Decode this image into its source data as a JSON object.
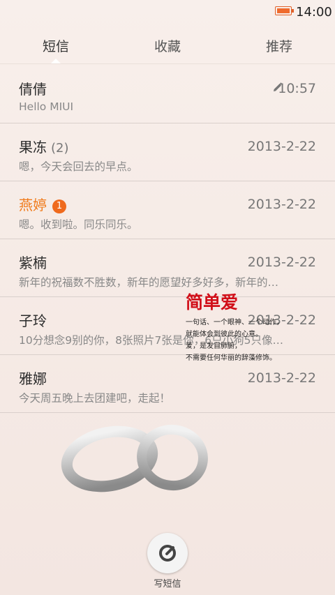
{
  "status_bar": {
    "time": "14:00"
  },
  "tabs": [
    {
      "label": "短信"
    },
    {
      "label": "收藏"
    },
    {
      "label": "推荐"
    }
  ],
  "conversations": [
    {
      "name": "倩倩",
      "count": "",
      "badge": "",
      "time": "10:57",
      "preview": "Hello MIUI"
    },
    {
      "name": "果冻",
      "count": "(2)",
      "badge": "",
      "time": "2013-2-22",
      "preview": "嗯，今天会回去的早点。"
    },
    {
      "name": "燕婷",
      "count": "",
      "badge": "1",
      "time": "2013-2-22",
      "preview": "嗯。收到啦。同乐同乐。"
    },
    {
      "name": "紫楠",
      "count": "",
      "badge": "",
      "time": "2013-2-22",
      "preview": "新年的祝福数不胜数，新年的愿望好多好多，新年的…"
    },
    {
      "name": "子玲",
      "count": "",
      "badge": "",
      "time": "2013-2-22",
      "preview": "10分想念9别的你，8张照片7张是你，6只小狗5只像…"
    },
    {
      "name": "雅娜",
      "count": "",
      "badge": "",
      "time": "2013-2-22",
      "preview": "今天周五晚上去团建吧，走起！"
    }
  ],
  "overlay_text": {
    "title": "简单爱",
    "line1": "一句话、一个眼神、一个动作，",
    "line2": "就能体会到彼此的心意。",
    "line3": "爱，是发自肺腑，",
    "line4": "不需要任何华丽的辞藻修饰。"
  },
  "compose": {
    "label": "写短信"
  },
  "colors": {
    "accent_orange": "#f07a1a",
    "badge": "#ef6a1d",
    "ad_red": "#d10f19"
  }
}
